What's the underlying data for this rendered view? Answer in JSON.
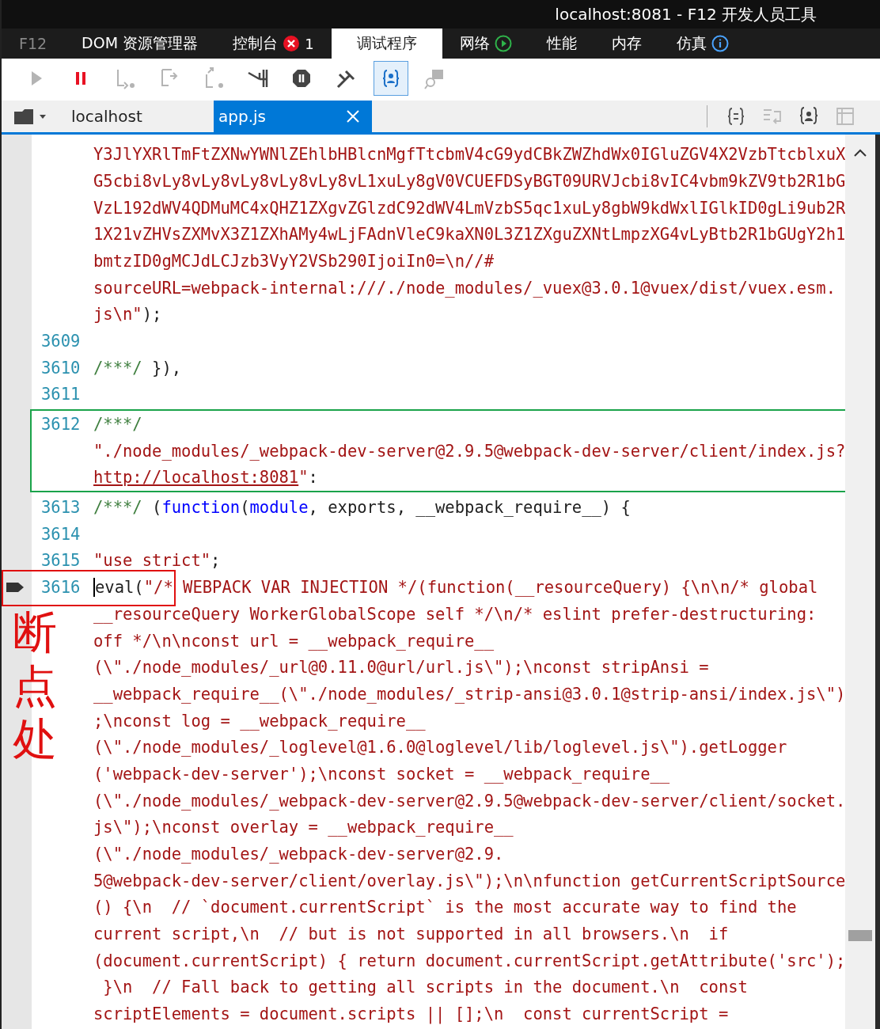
{
  "window": {
    "title": "localhost:8081 - F12 开发人员工具"
  },
  "tabs": [
    {
      "label": "F12",
      "selected": false,
      "dim": true
    },
    {
      "label": "DOM 资源管理器",
      "selected": false
    },
    {
      "label": "控制台",
      "selected": false,
      "badge": "1"
    },
    {
      "label": "调试程序",
      "selected": true
    },
    {
      "label": "网络",
      "selected": false
    },
    {
      "label": "性能",
      "selected": false
    },
    {
      "label": "内存",
      "selected": false
    },
    {
      "label": "仿真",
      "selected": false
    }
  ],
  "toolbar": [
    {
      "kind": "continue",
      "disabled": true,
      "on": false
    },
    {
      "kind": "pause",
      "disabled": false,
      "on": false
    },
    {
      "kind": "step-into",
      "disabled": true,
      "on": false
    },
    {
      "kind": "step-over",
      "disabled": true,
      "on": false
    },
    {
      "kind": "step-out",
      "disabled": true,
      "on": false
    },
    {
      "kind": "new-worker",
      "disabled": false,
      "on": false
    },
    {
      "kind": "exceptions",
      "disabled": false,
      "on": false
    },
    {
      "kind": "disable-breakpoints",
      "disabled": false,
      "on": false
    },
    {
      "kind": "pretty-print",
      "disabled": false,
      "on": true
    },
    {
      "kind": "just-my-code",
      "disabled": true,
      "on": false
    }
  ],
  "file_tabs": [
    {
      "label": "localhost",
      "selected": false
    },
    {
      "label": "app.js",
      "selected": true
    }
  ],
  "code": {
    "blocks": [
      {
        "boxed": false,
        "rows": [
          {
            "segments": [
              {
                "kind": "string",
                "text": "Y3JlYXRlTmFtZXNwYWNlZEhlbHBlcnMgfTtcbmV4cG9ydCBkZWZhdWx0IGluZGV4X2VzbTtcblxuX"
              }
            ]
          },
          {
            "segments": [
              {
                "kind": "string",
                "text": "G5cbi8vLy8vLy8vLy8vLy8vLy8vL1xuLy8gV0VCUEFDSyBGT09URVJcbi8vIC4vbm9kZV9tb2R1bG"
              }
            ]
          },
          {
            "segments": [
              {
                "kind": "string",
                "text": "VzL192dWV4QDMuMC4xQHZ1ZXgvZGlzdC92dWV4LmVzbS5qc1xuLy8gbW9kdWxlIGlkID0gLi9ub2R"
              }
            ]
          },
          {
            "segments": [
              {
                "kind": "string",
                "text": "1X21vZHVsZXMvX3Z1ZXhAMy4wLjFAdnVleC9kaXN0L3Z1ZXguZXNtLmpzXG4vLyBtb2R1bGUgY2h1"
              }
            ]
          },
          {
            "segments": [
              {
                "kind": "string",
                "text": "bmtzID0gMCJdLCJzb3VyY2VSb290IjoiIn0=\\n//#"
              }
            ]
          },
          {
            "segments": [
              {
                "kind": "string",
                "text": "sourceURL=webpack-internal:///./node_modules/_vuex@3.0.1@vuex/dist/vuex.esm."
              }
            ]
          },
          {
            "segments": [
              {
                "kind": "string",
                "text": "js\\n\""
              },
              {
                "kind": "plain",
                "text": ");"
              }
            ]
          },
          {
            "number": "3609",
            "segments": []
          },
          {
            "number": "3610",
            "segments": [
              {
                "kind": "comment",
                "text": "/***/"
              },
              {
                "kind": "plain",
                "text": " }),"
              }
            ]
          },
          {
            "number": "3611",
            "segments": []
          }
        ]
      },
      {
        "boxed": true,
        "rows": [
          {
            "number": "3612",
            "segments": [
              {
                "kind": "comment",
                "text": "/***/"
              }
            ]
          },
          {
            "segments": [
              {
                "kind": "string",
                "text": "\"./node_modules/_webpack-dev-server@2.9.5@webpack-dev-server/client/index.js?"
              }
            ]
          },
          {
            "segments": [
              {
                "kind": "link",
                "text": "http://localhost:8081"
              },
              {
                "kind": "string",
                "text": "\""
              },
              {
                "kind": "plain",
                "text": ":"
              }
            ]
          }
        ]
      },
      {
        "boxed": false,
        "rows": [
          {
            "number": "3613",
            "segments": [
              {
                "kind": "comment",
                "text": "/***/"
              },
              {
                "kind": "plain",
                "text": " ("
              },
              {
                "kind": "keyword",
                "text": "function"
              },
              {
                "kind": "plain",
                "text": "("
              },
              {
                "kind": "keyword",
                "text": "module"
              },
              {
                "kind": "plain",
                "text": ", exports, __webpack_require__) {"
              }
            ]
          },
          {
            "number": "3614",
            "segments": []
          },
          {
            "number": "3615",
            "segments": [
              {
                "kind": "string",
                "text": "\"use strict\""
              },
              {
                "kind": "plain",
                "text": ";"
              }
            ]
          },
          {
            "number": "3616",
            "breakpoint": true,
            "marked": true,
            "cursor": true,
            "segments": [
              {
                "kind": "plain",
                "text": "eval("
              },
              {
                "kind": "string",
                "text": "\"/* WEBPACK VAR INJECTION */(function(__resourceQuery) {\\n\\n/* global"
              }
            ]
          },
          {
            "segments": [
              {
                "kind": "string",
                "text": "__resourceQuery WorkerGlobalScope self */\\n/* eslint prefer-destructuring:"
              }
            ]
          },
          {
            "segments": [
              {
                "kind": "string",
                "text": "off */\\n\\nconst url = __webpack_require__"
              }
            ]
          },
          {
            "segments": [
              {
                "kind": "string",
                "text": "(\\\"./node_modules/_url@0.11.0@url/url.js\\\");\\nconst stripAnsi ="
              }
            ]
          },
          {
            "segments": [
              {
                "kind": "string",
                "text": "__webpack_require__(\\\"./node_modules/_strip-ansi@3.0.1@strip-ansi/index.js\\\")"
              }
            ]
          },
          {
            "segments": [
              {
                "kind": "string",
                "text": ";\\nconst log = __webpack_require__"
              }
            ]
          },
          {
            "segments": [
              {
                "kind": "string",
                "text": "(\\\"./node_modules/_loglevel@1.6.0@loglevel/lib/loglevel.js\\\").getLogger"
              }
            ]
          },
          {
            "segments": [
              {
                "kind": "string",
                "text": "('webpack-dev-server');\\nconst socket = __webpack_require__"
              }
            ]
          },
          {
            "segments": [
              {
                "kind": "string",
                "text": "(\\\"./node_modules/_webpack-dev-server@2.9.5@webpack-dev-server/client/socket."
              }
            ]
          },
          {
            "segments": [
              {
                "kind": "string",
                "text": "js\\\");\\nconst overlay = __webpack_require__"
              }
            ]
          },
          {
            "segments": [
              {
                "kind": "string",
                "text": "(\\\"./node_modules/_webpack-dev-server@2.9."
              }
            ]
          },
          {
            "segments": [
              {
                "kind": "string",
                "text": "5@webpack-dev-server/client/overlay.js\\\");\\n\\nfunction getCurrentScriptSource"
              }
            ]
          },
          {
            "segments": [
              {
                "kind": "string",
                "text": "() {\\n  // `document.currentScript` is the most accurate way to find the"
              }
            ]
          },
          {
            "segments": [
              {
                "kind": "string",
                "text": "current script,\\n  // but is not supported in all browsers.\\n  if"
              }
            ]
          },
          {
            "segments": [
              {
                "kind": "string",
                "text": "(document.currentScript) { return document.currentScript.getAttribute('src');"
              }
            ]
          },
          {
            "segments": [
              {
                "kind": "string",
                "text": " }\\n  // Fall back to getting all scripts in the document.\\n  const"
              }
            ]
          },
          {
            "segments": [
              {
                "kind": "string",
                "text": "scriptElements = document.scripts || [];\\n  const currentScript ="
              }
            ]
          }
        ]
      }
    ]
  },
  "breakpoint_note": "断点处"
}
